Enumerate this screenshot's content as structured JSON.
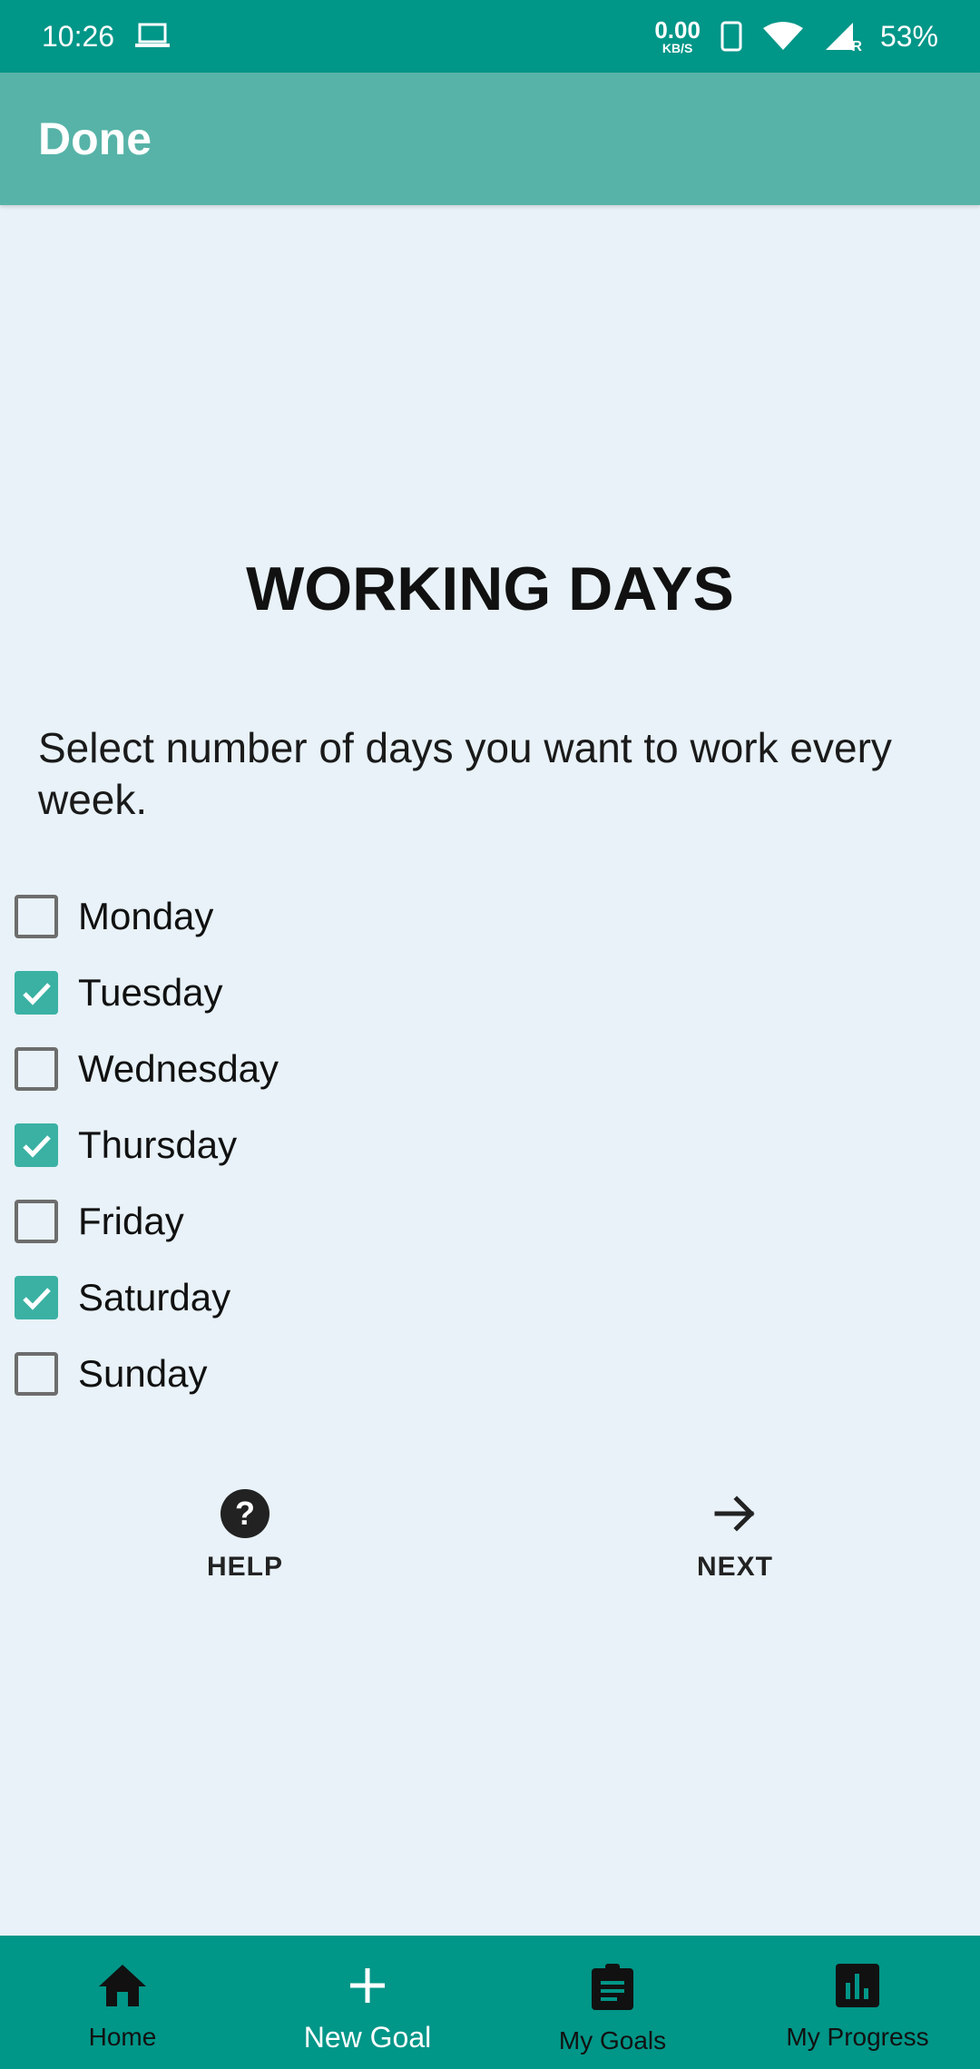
{
  "status_bar": {
    "time": "10:26",
    "net_speed": "0.00",
    "net_unit": "KB/S",
    "roaming": "R",
    "battery": "53%"
  },
  "app_bar": {
    "title": "Done"
  },
  "main": {
    "heading": "WORKING DAYS",
    "description": "Select number of days you want to work every week.",
    "days": [
      {
        "label": "Monday",
        "checked": false
      },
      {
        "label": "Tuesday",
        "checked": true
      },
      {
        "label": "Wednesday",
        "checked": false
      },
      {
        "label": "Thursday",
        "checked": true
      },
      {
        "label": "Friday",
        "checked": false
      },
      {
        "label": "Saturday",
        "checked": true
      },
      {
        "label": "Sunday",
        "checked": false
      }
    ],
    "help_label": "HELP",
    "next_label": "NEXT"
  },
  "bottom_nav": {
    "items": [
      {
        "label": "Home",
        "icon": "home-icon"
      },
      {
        "label": "New Goal",
        "icon": "plus-icon",
        "active": true
      },
      {
        "label": "My Goals",
        "icon": "clipboard-icon"
      },
      {
        "label": "My Progress",
        "icon": "bar-chart-icon"
      }
    ]
  },
  "colors": {
    "primary": "#009688",
    "app_bar": "#57b3a8",
    "checkbox_checked": "#3ab1a3",
    "background": "#e8f2f8"
  }
}
